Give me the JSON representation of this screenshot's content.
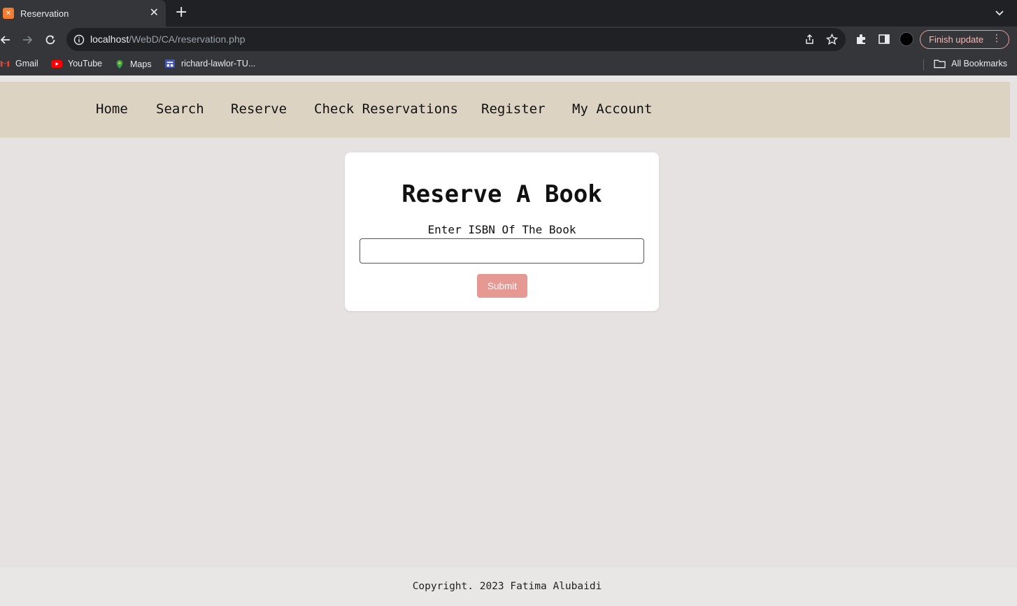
{
  "browser": {
    "tab": {
      "title": "Reservation",
      "favicon_icon": "xampp-icon"
    },
    "url": {
      "host": "localhost",
      "path": "/WebD/CA/reservation.php"
    },
    "finish_update_label": "Finish update",
    "bookmarks": [
      {
        "label": "Gmail",
        "icon": "gmail-icon"
      },
      {
        "label": "YouTube",
        "icon": "youtube-icon"
      },
      {
        "label": "Maps",
        "icon": "maps-icon"
      },
      {
        "label": "richard-lawlor-TU...",
        "icon": "board-icon"
      }
    ],
    "all_bookmarks_label": "All Bookmarks"
  },
  "nav": {
    "items": [
      "Home",
      "Search",
      "Reserve",
      "Check Reservations",
      "Register",
      "My Account"
    ]
  },
  "form": {
    "title": "Reserve A Book",
    "label": "Enter ISBN Of The Book",
    "isbn_value": "",
    "submit_label": "Submit"
  },
  "footer": {
    "text": "Copyright. 2023 Fatima Alubaidi"
  },
  "colors": {
    "navbar_bg": "#ddd3c2",
    "page_bg": "#e5e2e1",
    "submit_bg": "#e69893",
    "chrome_dark": "#202124",
    "chrome_toolbar": "#35363a"
  }
}
